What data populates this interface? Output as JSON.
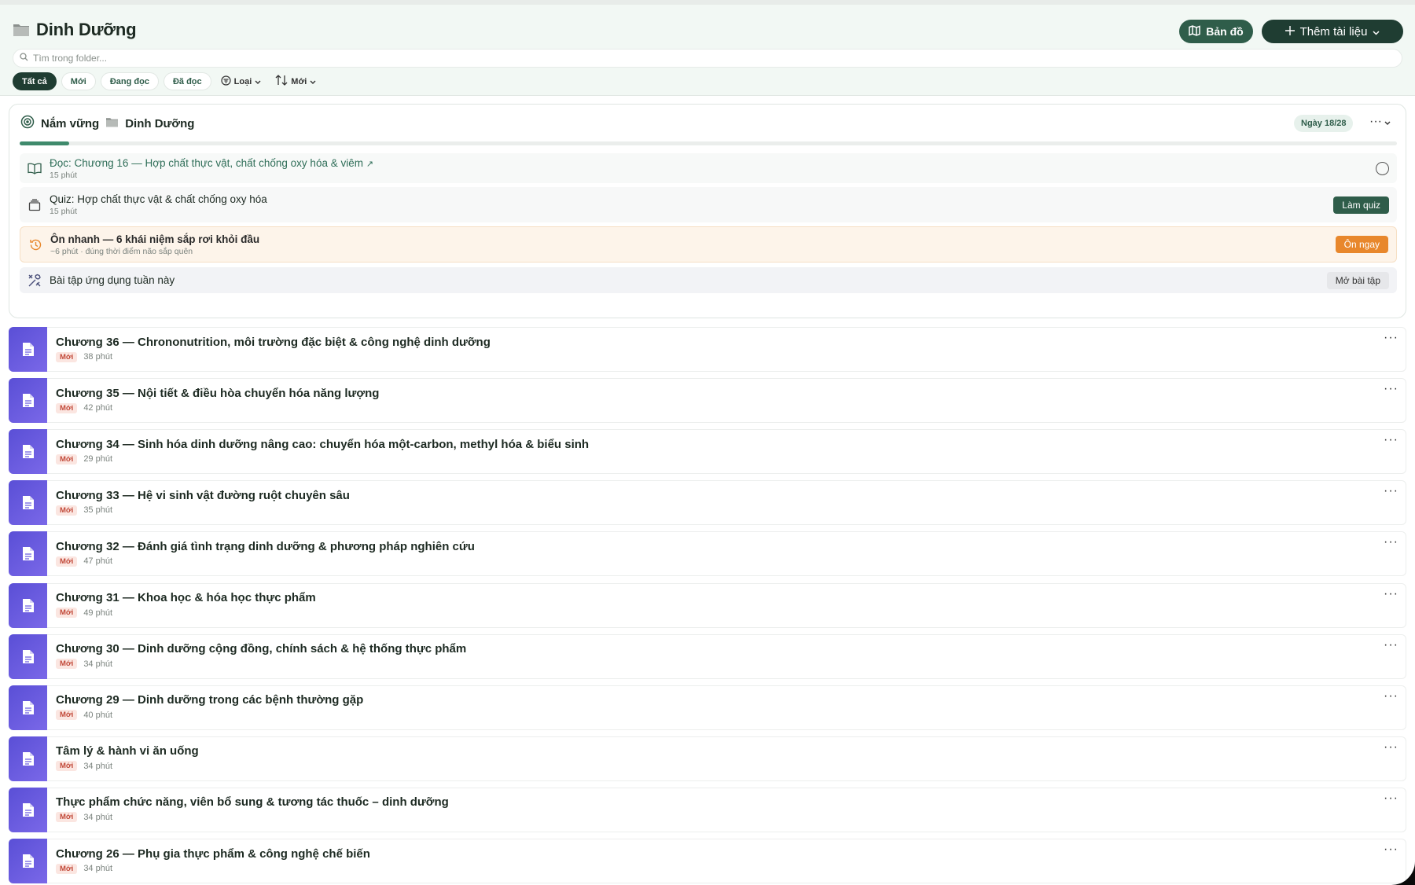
{
  "header": {
    "title": "Dinh Dưỡng",
    "map_button": "Bản đồ",
    "add_button": "Thêm tài liệu",
    "search_placeholder": "Tìm trong folder...",
    "filters": [
      "Tất cả",
      "Mới",
      "Đang đọc",
      "Đã đọc"
    ],
    "type_dropdown": "Loại",
    "sort_dropdown": "Mới"
  },
  "plan": {
    "prefix": "Nắm vững",
    "folder": "Dinh Dưỡng",
    "day_badge": "Ngày 18/28",
    "progress": 0.036,
    "tasks": {
      "read": {
        "title": "Đọc: Chương 16 — Hợp chất thực vật, chất chống oxy hóa & viêm",
        "sub": "15 phút",
        "arrow": "↗"
      },
      "quiz": {
        "title": "Quiz: Hợp chất thực vật & chất chống oxy hóa",
        "sub": "15 phút",
        "button": "Làm quiz"
      },
      "review": {
        "title": "Ôn nhanh — 6 khái niệm sắp rơi khỏi đầu",
        "sub": "~6 phút · đúng thời điểm não sắp quên",
        "button": "Ôn ngay"
      },
      "practice": {
        "title": "Bài tập ứng dụng tuần này",
        "button": "Mở bài tập"
      }
    }
  },
  "colors": {
    "accent": "#2f5d4a",
    "doc_icon": "#5a4fd6",
    "review_button": "#e8872c"
  },
  "documents": [
    {
      "title": "Chương 36 — Chrononutrition, môi trường đặc biệt & công nghệ dinh dưỡng",
      "badge": "Mới",
      "time": "38 phút"
    },
    {
      "title": "Chương 35 — Nội tiết & điều hòa chuyển hóa năng lượng",
      "badge": "Mới",
      "time": "42 phút"
    },
    {
      "title": "Chương 34 — Sinh hóa dinh dưỡng nâng cao: chuyển hóa một-carbon, methyl hóa & biểu sinh",
      "badge": "Mới",
      "time": "29 phút"
    },
    {
      "title": "Chương 33 — Hệ vi sinh vật đường ruột chuyên sâu",
      "badge": "Mới",
      "time": "35 phút"
    },
    {
      "title": "Chương 32 — Đánh giá tình trạng dinh dưỡng & phương pháp nghiên cứu",
      "badge": "Mới",
      "time": "47 phút"
    },
    {
      "title": "Chương 31 — Khoa học & hóa học thực phẩm",
      "badge": "Mới",
      "time": "49 phút"
    },
    {
      "title": "Chương 30 — Dinh dưỡng cộng đồng, chính sách & hệ thống thực phẩm",
      "badge": "Mới",
      "time": "34 phút"
    },
    {
      "title": "Chương 29 — Dinh dưỡng trong các bệnh thường gặp",
      "badge": "Mới",
      "time": "40 phút"
    },
    {
      "title": "Tâm lý & hành vi ăn uống",
      "badge": "Mới",
      "time": "34 phút"
    },
    {
      "title": "Thực phẩm chức năng, viên bổ sung & tương tác thuốc – dinh dưỡng",
      "badge": "Mới",
      "time": "34 phút"
    },
    {
      "title": "Chương 26 — Phụ gia thực phẩm & công nghệ chế biến",
      "badge": "Mới",
      "time": "34 phút"
    }
  ]
}
